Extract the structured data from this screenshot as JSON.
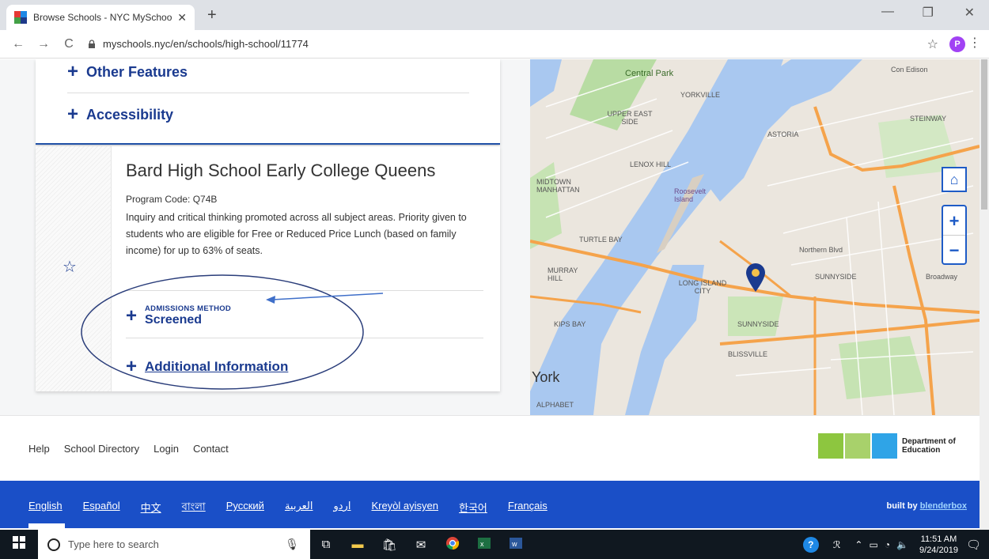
{
  "browser": {
    "tab_title": "Browse Schools - NYC MySchool",
    "url": "myschools.nyc/en/schools/high-school/11774",
    "profile_initial": "P"
  },
  "features": {
    "other": "Other Features",
    "accessibility": "Accessibility"
  },
  "school": {
    "name": "Bard High School Early College Queens",
    "program_code": "Program Code: Q74B",
    "description": "Inquiry and critical thinking promoted across all subject areas. Priority given to students who are eligible for Free or Reduced Price Lunch (based on family income) for up to 63% of seats.",
    "admissions_label": "ADMISSIONS METHOD",
    "admissions_value": "Screened",
    "additional_info": "Additional Information"
  },
  "map": {
    "labels": {
      "central_park": "Central Park",
      "upper_east_side": "UPPER EAST SIDE",
      "yorkville": "YORKVILLE",
      "lenox_hill": "LENOX HILL",
      "midtown": "MIDTOWN MANHATTAN",
      "roosevelt": "Roosevelt Island",
      "turtle_bay": "TURTLE BAY",
      "murray_hill": "MURRAY HILL",
      "kips_bay": "KIPS BAY",
      "long_island_city": "LONG ISLAND CITY",
      "sunnyside": "SUNNYSIDE",
      "sunnyside2": "SUNNYSIDE",
      "astoria": "ASTORIA",
      "steinway": "STEINWAY",
      "blissville": "BLISSVILLE",
      "york": "York",
      "alphabet": "ALPHABET",
      "con_edison": "Con Edison",
      "northern_blvd": "Northern Blvd",
      "broadway": "Broadway"
    },
    "zoom_in": "+",
    "zoom_out": "−"
  },
  "footer": {
    "links": [
      "Help",
      "School Directory",
      "Login",
      "Contact"
    ],
    "dept_line1": "Department of",
    "dept_line2": "Education",
    "languages": [
      "English",
      "Español",
      "中文",
      "বাংলা",
      "Русский",
      "العربية",
      "اردو",
      "Kreyòl ayisyen",
      "한국어",
      "Français"
    ],
    "built_by": "built by",
    "built_by_link": "blenderbox"
  },
  "taskbar": {
    "search_placeholder": "Type here to search",
    "time": "11:51 AM",
    "date": "9/24/2019"
  },
  "colors": {
    "brand_blue": "#1a3a8f",
    "lang_bar": "#1a4fc7",
    "nyc_green": "#8dc63f",
    "nyc_blue": "#2fa4e7"
  }
}
